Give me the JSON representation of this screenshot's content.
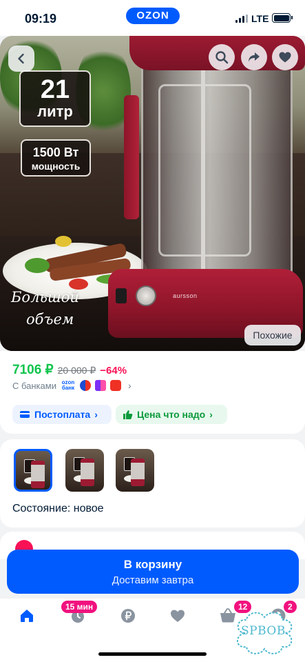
{
  "status_bar": {
    "time": "09:19",
    "brand": "OZON",
    "network": "LTE"
  },
  "hero": {
    "volume_value": "21",
    "volume_unit": "литр",
    "power_value": "1500 Вт",
    "power_label": "мощность",
    "caption_line1": "Большой",
    "caption_line2": "объем",
    "device_brand": "aursson",
    "similar_label": "Похожие",
    "icons": [
      "chevron-left-icon",
      "search-icon",
      "share-icon",
      "heart-icon"
    ]
  },
  "price": {
    "current": "7106 ₽",
    "old": "20 000 ₽",
    "discount": "−64%",
    "banks_label": "С банками",
    "ozon_bank_line1": "ozon",
    "ozon_bank_line2": "банк"
  },
  "chips": {
    "postpay": "Постоплата",
    "price_good": "Цена что надо"
  },
  "gallery": {
    "condition": "Состояние: новое",
    "thumb_count": 3,
    "active_index": 0
  },
  "cart": {
    "title": "В корзину",
    "subtitle": "Доставим завтра"
  },
  "bottom_nav": {
    "items": [
      "home",
      "fresh",
      "finance",
      "favorites",
      "cart",
      "profile"
    ],
    "fresh_badge": "15 мин",
    "cart_badge": "12",
    "profile_badge": "2"
  },
  "watermark": {
    "text": "SPBOB"
  },
  "colors": {
    "accent": "#005bff",
    "price": "#10c44c",
    "discount": "#f91155",
    "badge": "#f1117e"
  }
}
